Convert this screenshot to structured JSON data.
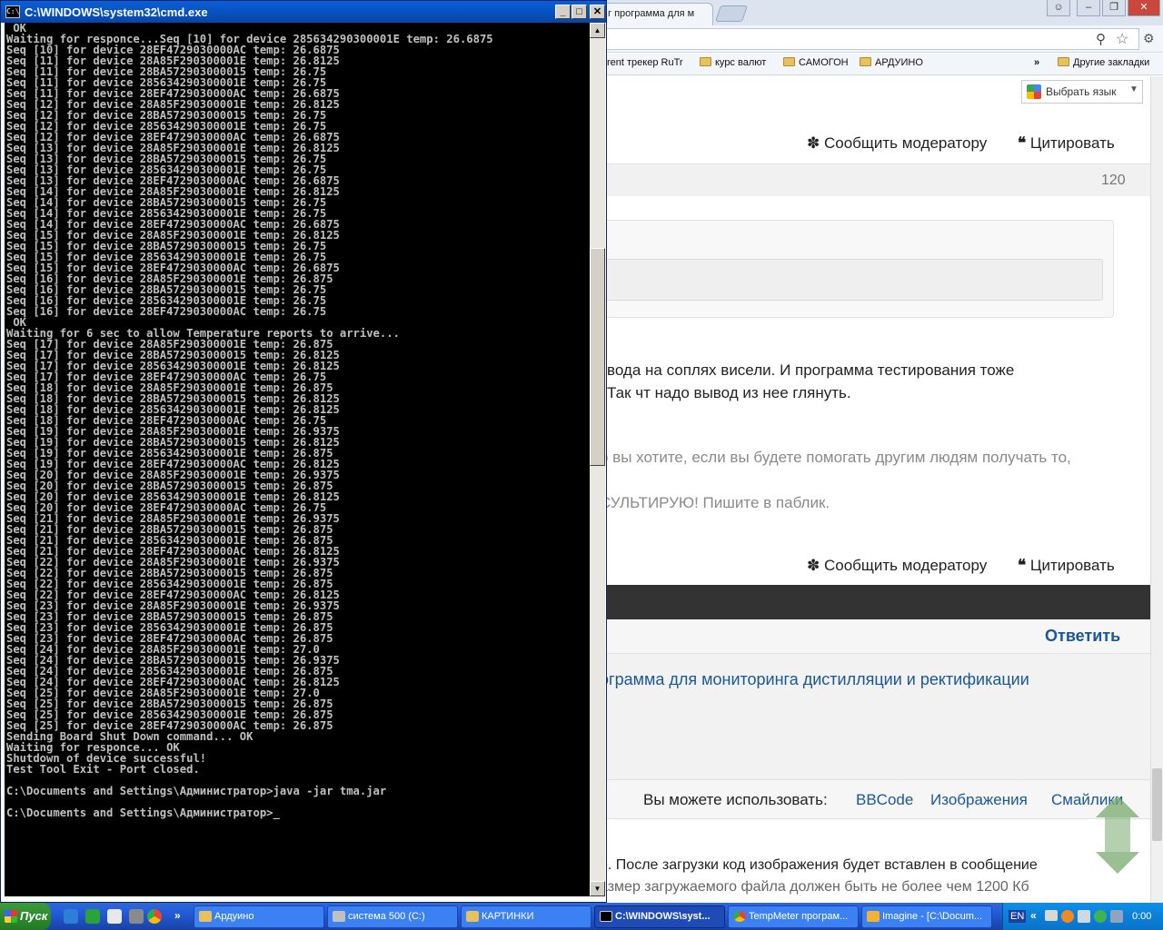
{
  "browser": {
    "tab_title": "г программа для м",
    "bookmarks": [
      "rent трекер RuTr",
      "курс валют",
      "САМОГОН",
      "АРДУИНО"
    ],
    "bookmarks_more": "»",
    "other_bookmarks": "Другие закладки",
    "translate_button": "Выбрать язык",
    "report_label": "Сообщить модератору",
    "quote_label": "Цитировать",
    "post_number": "120",
    "post_line1": "вода на соплях висели. И программа тестирования тоже",
    "post_line2": "Так чт надо вывод из нее глянуть.",
    "signature_line1": "о вы хотите, если вы будете помогать другим людям получать то,",
    "signature_line2": "СУЛЬТИРУЮ! Пишите в паблик.",
    "reply_button": "Ответить",
    "topic_title": "ограмма для мониторинга дистилляции и ректификации",
    "can_use_label": "Вы можете использовать:",
    "format_links": [
      "BBCode",
      "Изображения",
      "Смайлики"
    ],
    "upload_hint": "е. После загрузки код изображения будет вставлен в сообщение",
    "upload_hint2": "азмер загружаемого файла должен быть не более чем 1200 Кб"
  },
  "cmd": {
    "title": "C:\\WINDOWS\\system32\\cmd.exe",
    "lines": [
      " OK",
      "Waiting for responce...Seq [10] for device 285634290300001E temp: 26.6875",
      "Seq [10] for device 28EF4729030000AC temp: 26.6875",
      "Seq [11] for device 28A85F290300001E temp: 26.8125",
      "Seq [11] for device 28BA572903000015 temp: 26.75",
      "Seq [11] for device 285634290300001E temp: 26.75",
      "Seq [11] for device 28EF4729030000AC temp: 26.6875",
      "Seq [12] for device 28A85F290300001E temp: 26.8125",
      "Seq [12] for device 28BA572903000015 temp: 26.75",
      "Seq [12] for device 285634290300001E temp: 26.75",
      "Seq [12] for device 28EF4729030000AC temp: 26.6875",
      "Seq [13] for device 28A85F290300001E temp: 26.8125",
      "Seq [13] for device 28BA572903000015 temp: 26.75",
      "Seq [13] for device 285634290300001E temp: 26.75",
      "Seq [13] for device 28EF4729030000AC temp: 26.6875",
      "Seq [14] for device 28A85F290300001E temp: 26.8125",
      "Seq [14] for device 28BA572903000015 temp: 26.75",
      "Seq [14] for device 285634290300001E temp: 26.75",
      "Seq [14] for device 28EF4729030000AC temp: 26.6875",
      "Seq [15] for device 28A85F290300001E temp: 26.8125",
      "Seq [15] for device 28BA572903000015 temp: 26.75",
      "Seq [15] for device 285634290300001E temp: 26.75",
      "Seq [15] for device 28EF4729030000AC temp: 26.6875",
      "Seq [16] for device 28A85F290300001E temp: 26.875",
      "Seq [16] for device 28BA572903000015 temp: 26.75",
      "Seq [16] for device 285634290300001E temp: 26.75",
      "Seq [16] for device 28EF4729030000AC temp: 26.75",
      " OK",
      "Waiting for 6 sec to allow Temperature reports to arrive...",
      "Seq [17] for device 28A85F290300001E temp: 26.875",
      "Seq [17] for device 28BA572903000015 temp: 26.8125",
      "Seq [17] for device 285634290300001E temp: 26.8125",
      "Seq [17] for device 28EF4729030000AC temp: 26.75",
      "Seq [18] for device 28A85F290300001E temp: 26.875",
      "Seq [18] for device 28BA572903000015 temp: 26.8125",
      "Seq [18] for device 285634290300001E temp: 26.8125",
      "Seq [18] for device 28EF4729030000AC temp: 26.75",
      "Seq [19] for device 28A85F290300001E temp: 26.9375",
      "Seq [19] for device 28BA572903000015 temp: 26.8125",
      "Seq [19] for device 285634290300001E temp: 26.875",
      "Seq [19] for device 28EF4729030000AC temp: 26.8125",
      "Seq [20] for device 28A85F290300001E temp: 26.9375",
      "Seq [20] for device 28BA572903000015 temp: 26.875",
      "Seq [20] for device 285634290300001E temp: 26.8125",
      "Seq [20] for device 28EF4729030000AC temp: 26.75",
      "Seq [21] for device 28A85F290300001E temp: 26.9375",
      "Seq [21] for device 28BA572903000015 temp: 26.875",
      "Seq [21] for device 285634290300001E temp: 26.875",
      "Seq [21] for device 28EF4729030000AC temp: 26.8125",
      "Seq [22] for device 28A85F290300001E temp: 26.9375",
      "Seq [22] for device 28BA572903000015 temp: 26.875",
      "Seq [22] for device 285634290300001E temp: 26.875",
      "Seq [22] for device 28EF4729030000AC temp: 26.8125",
      "Seq [23] for device 28A85F290300001E temp: 26.9375",
      "Seq [23] for device 28BA572903000015 temp: 26.875",
      "Seq [23] for device 285634290300001E temp: 26.875",
      "Seq [23] for device 28EF4729030000AC temp: 26.875",
      "Seq [24] for device 28A85F290300001E temp: 27.0",
      "Seq [24] for device 28BA572903000015 temp: 26.9375",
      "Seq [24] for device 285634290300001E temp: 26.875",
      "Seq [24] for device 28EF4729030000AC temp: 26.8125",
      "Seq [25] for device 28A85F290300001E temp: 27.0",
      "Seq [25] for device 28BA572903000015 temp: 26.875",
      "Seq [25] for device 285634290300001E temp: 26.875",
      "Seq [25] for device 28EF4729030000AC temp: 26.875",
      "Sending Board Shut Down command... OK",
      "Waiting for responce... OK",
      "Shutdown of device successful!",
      "Test Tool Exit - Port closed.",
      "",
      "C:\\Documents and Settings\\Администратор>java -jar tma.jar",
      "",
      "C:\\Documents and Settings\\Администратор>_"
    ]
  },
  "taskbar": {
    "start_label": "Пуск",
    "more": "»",
    "buttons": [
      {
        "label": "Ардуино",
        "icon_color": "#e8c15a"
      },
      {
        "label": "система 500 (C:)",
        "icon_color": "#c0c0c0"
      },
      {
        "label": "КАРТИНКИ",
        "icon_color": "#e8c15a"
      },
      {
        "label": "C:\\WINDOWS\\syst...",
        "icon_color": "#000000"
      },
      {
        "label": "TempMeter програм...",
        "icon_color": "#e24a3a"
      },
      {
        "label": "Imagine - [C:\\Docum...",
        "icon_color": "#f2b233"
      }
    ],
    "lang": "EN",
    "tray_more": "«",
    "clock": "0:00"
  },
  "colors": {
    "link": "#1a5799",
    "dark_bar": "#333333",
    "cmd_text": "#c0c0c0"
  }
}
